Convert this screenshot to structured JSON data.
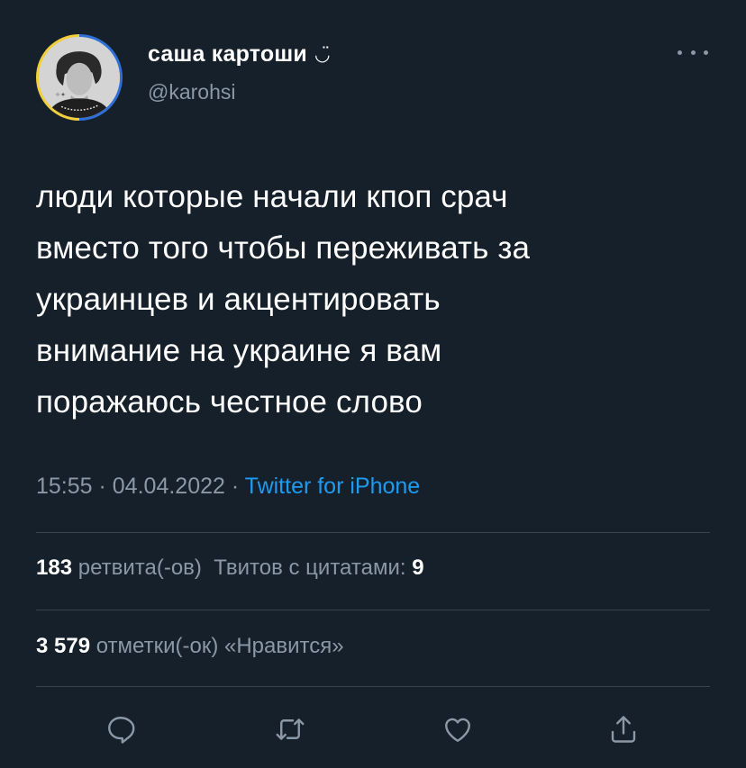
{
  "user": {
    "display_name": "саша картоши",
    "name_emoji": "◡̈",
    "handle": "@karohsi",
    "avatar_icon": "profile-avatar"
  },
  "tweet": {
    "text_lines": [
      "люди которые начали кпоп срач",
      "вместо того чтобы переживать за",
      "украинцев и акцентировать",
      "внимание на украине я вам",
      "поражаюсь честное слово"
    ]
  },
  "meta": {
    "time": "15:55",
    "separator": " · ",
    "date": "04.04.2022",
    "source": "Twitter for iPhone"
  },
  "stats": {
    "retweets_count": "183",
    "retweets_label": "ретвита(-ов)",
    "quotes_label": "Твитов с цитатами:",
    "quotes_count": "9",
    "likes_count": "3 579",
    "likes_label": "отметки(-ок) «Нравится»"
  },
  "actions": {
    "reply_icon": "reply-icon",
    "retweet_icon": "retweet-icon",
    "like_icon": "heart-icon",
    "share_icon": "share-icon"
  },
  "colors": {
    "background": "#15202b",
    "text_primary": "#ffffff",
    "text_secondary": "#8b98a5",
    "link": "#1d9bf0",
    "divider": "#38444d"
  }
}
